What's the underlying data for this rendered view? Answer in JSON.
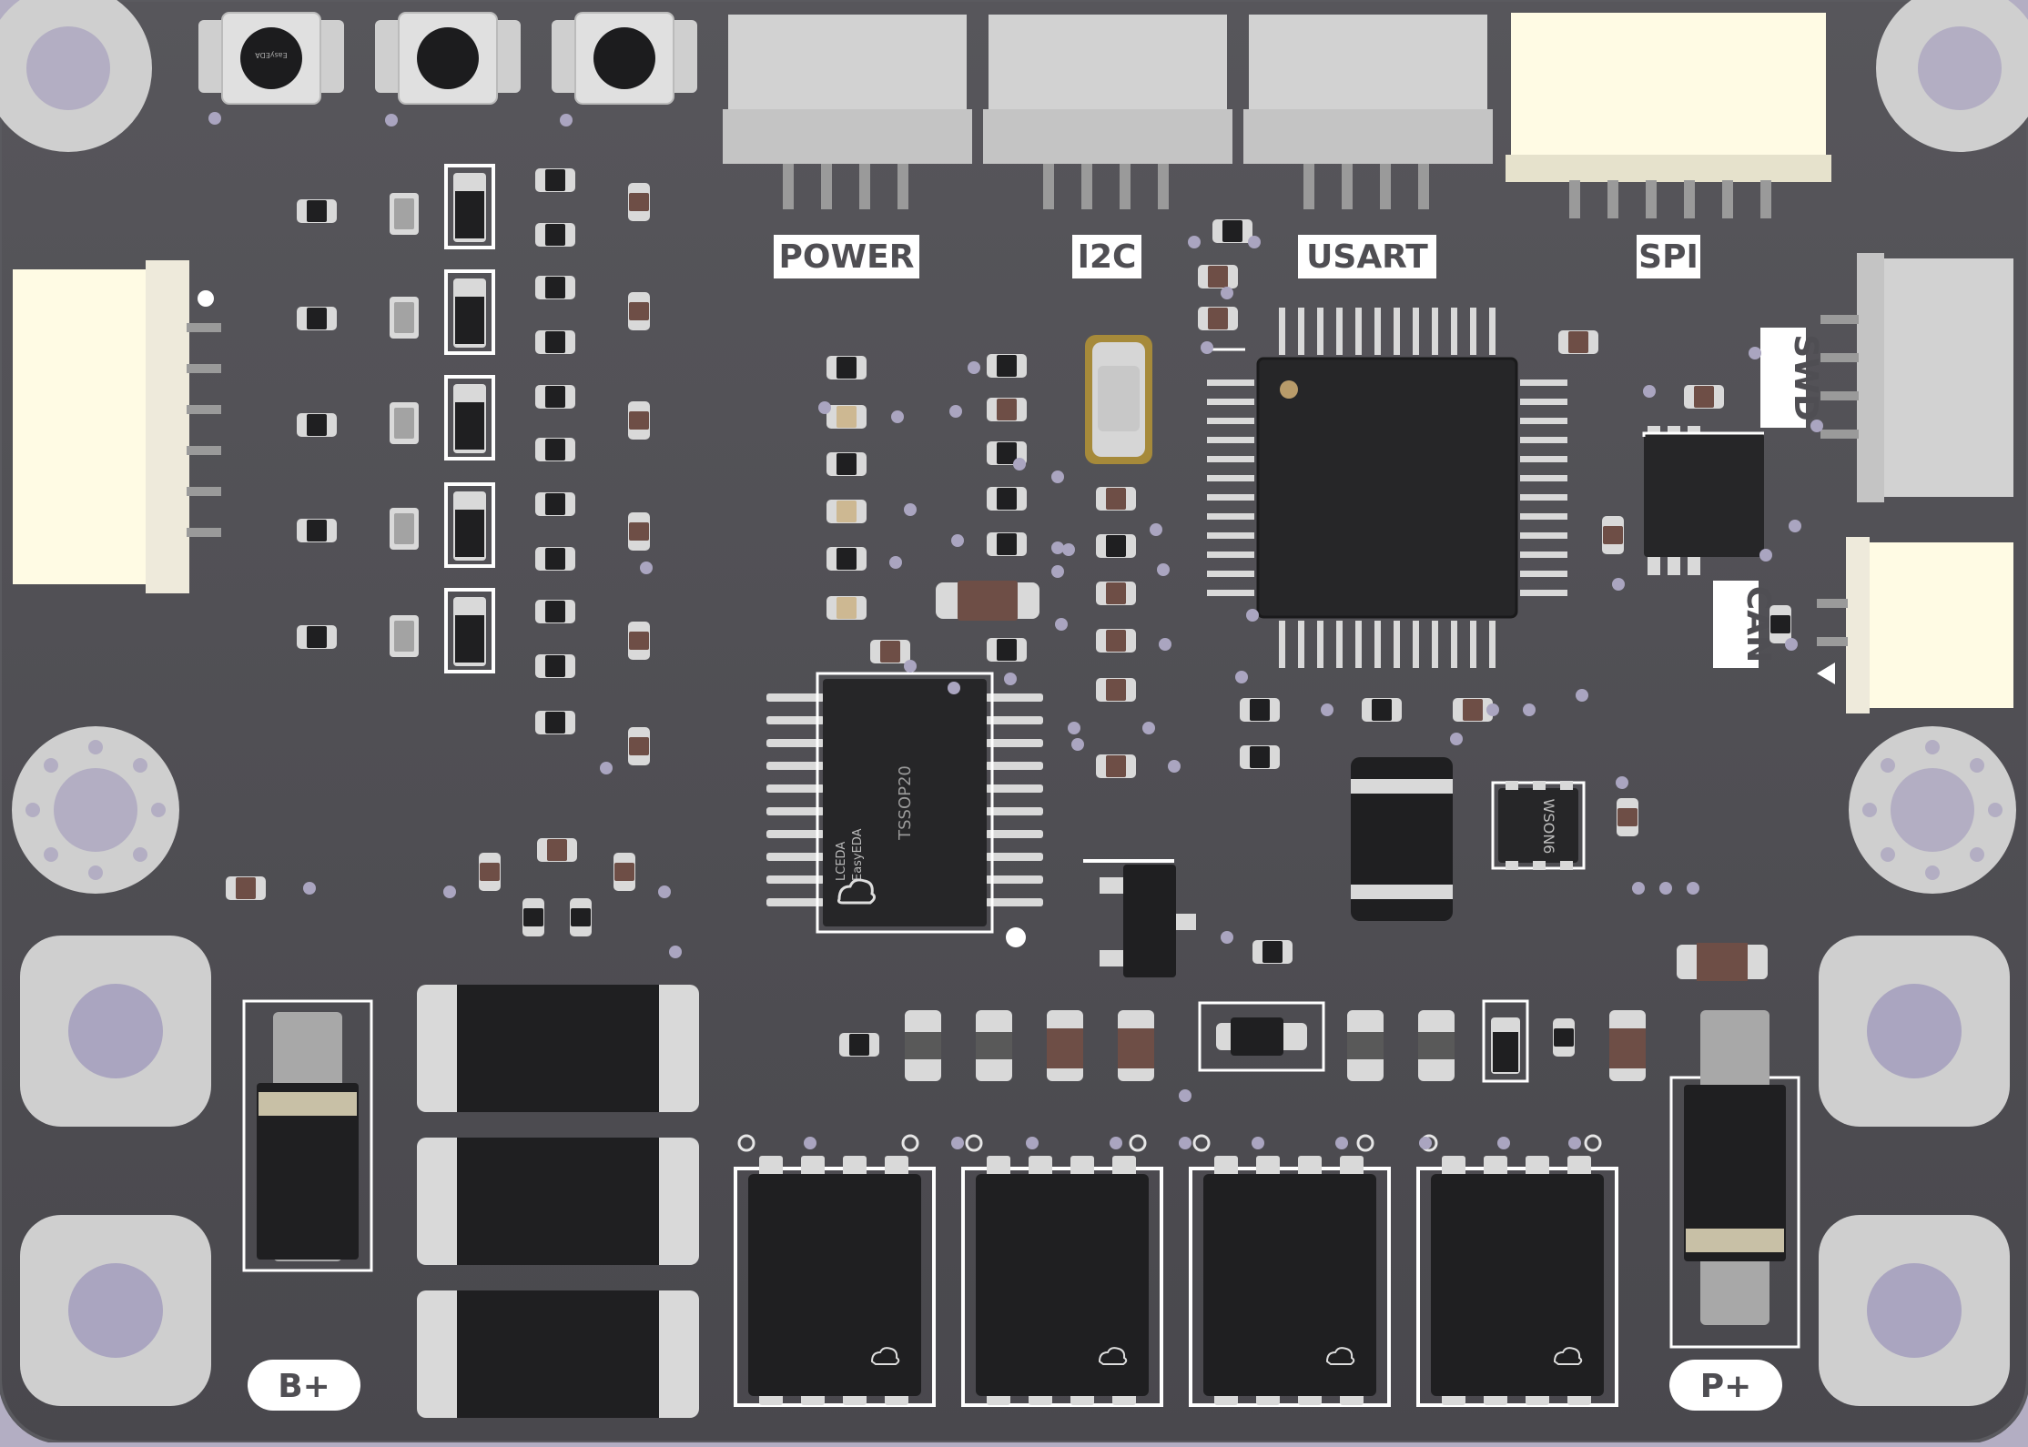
{
  "board": {
    "colors": {
      "background": "#b3aec3",
      "pcb": "#4f4e53",
      "pcb_dark": "#48474c",
      "silk": "#ffffff",
      "pad": "#dcdcdc",
      "hole": "#aaa5c0",
      "ic_body": "#262628",
      "connector_gray": "#cfcfcf",
      "connector_cream": "#fffbe4",
      "resistor": "#6e4e46",
      "capacitor_tan": "#cdb892"
    },
    "labels": {
      "power": "POWER",
      "i2c": "I2C",
      "usart": "USART",
      "spi": "SPI",
      "swd": "SWD",
      "can": "CAN",
      "b_plus": "B+",
      "p_plus": "P+"
    },
    "chip_texts": {
      "tssop_package": "TSSOP20",
      "wson_package": "WSON6",
      "brand_lceda": "LCEDA",
      "brand_easyeda": "EasyEDA"
    },
    "icons": {
      "logo": "cloud-logo-icon",
      "pin1_marker": "pin1-dot-icon",
      "mount_hole": "mounting-hole-icon"
    }
  }
}
